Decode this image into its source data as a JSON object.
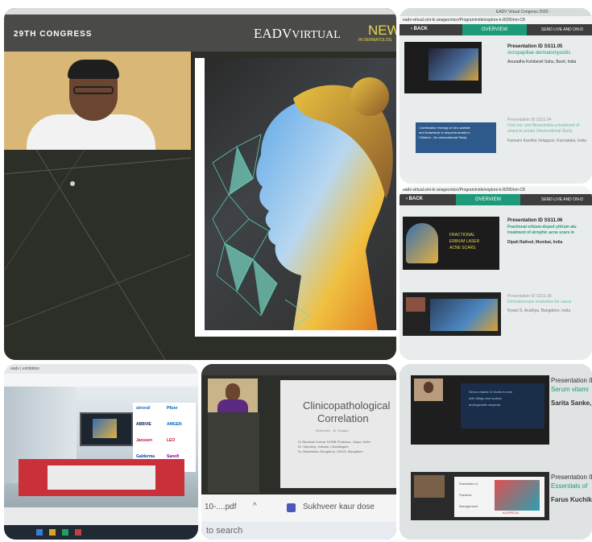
{
  "main": {
    "congress_label": "29TH CONGRESS",
    "brand": "EADV",
    "brand_suffix": "IRTUAL",
    "new_label": "NEW F",
    "sub_label": "IN DERMATOLOG"
  },
  "top_right": {
    "url": "eadv-virtual.smi-kr.anagecmtcn/Program/rstle/explore-k-8205Inm-C8",
    "tab_title": "EADV Virtual Congress 2020 -",
    "back_label": "‹ BACK",
    "overview_label": "OVERVIEW",
    "send_label": "SEND LIVE AND ON-D",
    "items": [
      {
        "id": "Presentation ID SS11.05",
        "title": "Acropapillae dermatomyositis",
        "author": "Anuradha Kshitanvil Sahu, Bunit, India"
      },
      {
        "id": "Presentation ID SS11.04",
        "title": "Oral zinc and Bimaximida-a treatment of",
        "title2": "alopecia areata Observational Study",
        "author": "Kamaim Kavitha Velappan, Karnataka, India",
        "thumb_line1": "Combination therapy of zinc acetate",
        "thumb_line2": "and levamisole in alopecia areata in",
        "thumb_line3": "Children - An observational Study"
      }
    ]
  },
  "mid_right": {
    "url": "eadv-virtual.smi-kr.anagecmtcn/Program/rstle/explore-k-8205Inm-C8",
    "back_label": "‹ BACK",
    "overview_label": "OVERVIEW",
    "send_label": "SEND LIVE AND ON-D",
    "items": [
      {
        "id": "Presentation ID SS11.06",
        "title": "Fractional erbium-doped yttrium alu",
        "title2": "treatment of atrophic acne scars in",
        "author": "Dipali Rathod, Mumbai, India",
        "thumb_line1": "FRACTIONAL",
        "thumb_line2": "ERBIUM LASER",
        "thumb_line3": "ACNE SCARS"
      },
      {
        "id": "Presentation ID SS11.08",
        "title": "Dermatoscopic evaluation for cause",
        "author": "Kiyani S. Acathya, Bangalore, India"
      }
    ]
  },
  "bottom_left": {
    "tabs": "eadv  |  exhibition",
    "booths": [
      "almirall",
      "Pfizer",
      "ABBVIE",
      "AMGEN",
      "Janssen",
      "LEO",
      "Galderma",
      "Sanofi"
    ]
  },
  "bottom_middle": {
    "slide_title": "Clinicopathological",
    "slide_title2": "Correlation",
    "slide_sub": "Moderator : Dr. Sutapa",
    "slide_line1": "Dr Bhushan Kumar, DHNB Professor, Jaipur, Delhi",
    "slide_line2": "Dr. Sandeep, Kolkata, Chhattisgarh",
    "slide_line3": "Dr. Bhadrasha, Bengaluru, DBGS, Mangalore",
    "download_file": "10-....pdf",
    "chevron": "^",
    "user_name": "Sukhveer kaur dose",
    "search": "to search"
  },
  "bottom_right": {
    "items": [
      {
        "id": "Presentation ID",
        "title": "Serum vitami",
        "author": "Sarita Sanke, ",
        "slide_text1": "Serum vitamin D levels in men",
        "slide_text2": "with vitiligo and sodium",
        "slide_text3": "androgenetic alopecia"
      },
      {
        "id": "Presentation ID",
        "title": "Essentials of",
        "author": "Farus Kuchikal",
        "slide_lines": [
          "Essentials of",
          "Practical",
          "Management"
        ],
        "slide_badge": "ALOPECIA"
      }
    ]
  }
}
